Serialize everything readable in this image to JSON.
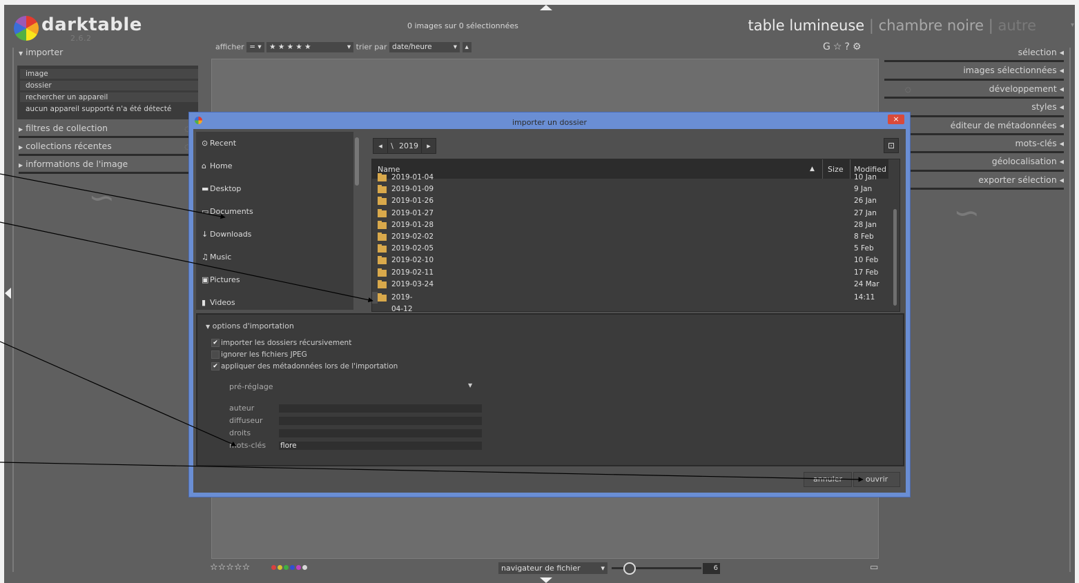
{
  "app": {
    "name": "darktable",
    "version": "2.6.2",
    "image_count": "0 images sur 0 sélectionnées",
    "views": [
      "table lumineuse",
      "chambre noire",
      "autre"
    ],
    "view_separator": "|"
  },
  "left_panel": {
    "import_section": "importer",
    "import_items": [
      "image",
      "dossier",
      "rechercher un appareil",
      "aucun appareil supporté n'a été détecté"
    ],
    "sections": [
      "filtres de collection",
      "collections récentes",
      "informations de l'image"
    ]
  },
  "right_panel": {
    "sections": [
      "sélection",
      "images sélectionnées",
      "développement",
      "styles",
      "éditeur de métadonnées",
      "mots-clés",
      "géolocalisation",
      "exporter sélection"
    ]
  },
  "filter_bar": {
    "show_label": "afficher",
    "comparator": "=",
    "rating": "★ ★ ★ ★ ★",
    "sort_label": "trier par",
    "sort_value": "date/heure"
  },
  "top_tools": [
    "G",
    "☆",
    "?",
    "⚙"
  ],
  "bottom_bar": {
    "stars": "☆☆☆☆☆",
    "color_labels": [
      "#d94040",
      "#d8c030",
      "#40b040",
      "#3050d0",
      "#c040c0",
      "#d8d8d8"
    ],
    "navigator": "navigateur de fichier",
    "zoom_value": "6"
  },
  "dialog": {
    "title": "importer un dossier",
    "close": "×",
    "places": [
      {
        "icon": "⊙",
        "label": "Recent"
      },
      {
        "icon": "⌂",
        "label": "Home"
      },
      {
        "icon": "▬",
        "label": "Desktop"
      },
      {
        "icon": "▭",
        "label": "Documents"
      },
      {
        "icon": "↓",
        "label": "Downloads"
      },
      {
        "icon": "♫",
        "label": "Music"
      },
      {
        "icon": "▣",
        "label": "Pictures"
      },
      {
        "icon": "▮",
        "label": "Videos"
      }
    ],
    "path": {
      "back": "◂",
      "sep": "\\",
      "current": "2019",
      "forward": "▸"
    },
    "columns": {
      "name": "Name",
      "size": "Size",
      "modified": "Modified"
    },
    "files": [
      {
        "name": "2019-01-04",
        "modified": "10 Jan"
      },
      {
        "name": "2019-01-09",
        "modified": "9 Jan"
      },
      {
        "name": "2019-01-26",
        "modified": "26 Jan"
      },
      {
        "name": "2019-01-27",
        "modified": "27 Jan"
      },
      {
        "name": "2019-01-28",
        "modified": "28 Jan"
      },
      {
        "name": "2019-02-02",
        "modified": "8 Feb"
      },
      {
        "name": "2019-02-05",
        "modified": "5 Feb"
      },
      {
        "name": "2019-02-10",
        "modified": "10 Feb"
      },
      {
        "name": "2019-02-11",
        "modified": "17 Feb"
      },
      {
        "name": "2019-03-24",
        "modified": "24 Mar"
      },
      {
        "name": "2019-04-12",
        "modified": "14:11"
      }
    ],
    "options": {
      "header": "options d'importation",
      "recursive": "importer les dossiers récursivement",
      "ignore_jpeg": "ignorer les fichiers JPEG",
      "apply_metadata": "appliquer des métadonnées lors de l'importation",
      "preset": "pré-réglage",
      "author_label": "auteur",
      "author_value": "",
      "publisher_label": "diffuseur",
      "publisher_value": "",
      "rights_label": "droits",
      "rights_value": "",
      "keywords_label": "mots-clés",
      "keywords_value": "flore"
    },
    "cancel": "annuler",
    "open": "ouvrir"
  }
}
